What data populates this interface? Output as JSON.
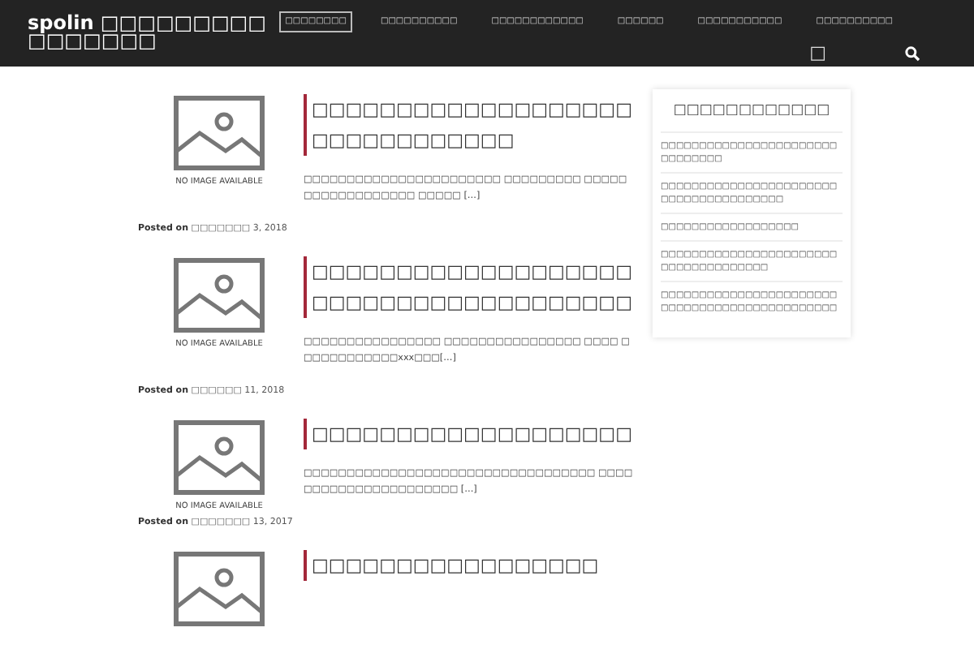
{
  "header": {
    "site_title": "spolin □□□□□□□□□ □□□□□□□",
    "nav": [
      {
        "label": "□□□□□□□□",
        "selected": true
      },
      {
        "label": "□□□□□□□□□□",
        "selected": false
      },
      {
        "label": "□□□□□□□□□□□□",
        "selected": false
      },
      {
        "label": "□□□□□□",
        "selected": false
      },
      {
        "label": "□□□□□□□□□□□",
        "selected": false
      },
      {
        "label": "□□□□□□□□□□",
        "selected": false
      },
      {
        "label": "□",
        "selected": false
      }
    ]
  },
  "posts": [
    {
      "image_text": "NO IMAGE AVAILABLE",
      "title": "□□□□□□□□□□□□□□□□□□□□□□□□□□□□□□□",
      "excerpt": "□□□□□□□□□□□□□□□□□□□□□□□ □□□□□□□□□ □□□□□□□□□□□□□□□□□□ □□□□□ […]",
      "posted_label": "Posted on",
      "date": "□□□□□□□ 3, 2018"
    },
    {
      "image_text": "NO IMAGE AVAILABLE",
      "title": "□□□□□□□□□□□□□□□□□□□□□□□□□□□□□□□□□□□□□□",
      "excerpt": "□□□□□□□□□□□□□□□□ □□□□□□□□□□□□□□□□ □□□□ □□□□□□□□□□□□xxx□□□[…]",
      "posted_label": "Posted on",
      "date": "□□□□□□ 11, 2018"
    },
    {
      "image_text": "NO IMAGE AVAILABLE",
      "title": "□□□□□□□□□□□□□□□□□□□",
      "excerpt": "□□□□□□□□□□□□□□□□□□□□□□□□□□□□□□□□□□ □□□□□□□□□□□□□□□□□□□□□□ […]",
      "posted_label": "Posted on",
      "date": "□□□□□□□ 13, 2017"
    },
    {
      "title": "□□□□□□□□□□□□□□□□□"
    }
  ],
  "sidebar": {
    "title": "□□□□□□□□□□□□",
    "items": [
      "□□□□□□□□□□□□□□□□□□□□□□□□□□□□□□□",
      "□□□□□□□□□□□□□□□□□□□□□□□□□□□□□□□□□□□□□□□",
      "□□□□□□□□□□□□□□□□□□",
      "□□□□□□□□□□□□□□□□□□□□□□□□□□□□□□□□□□□□□",
      "□□□□□□□□□□□□□□□□□□□□□□□□□□□□□□□□□□□□□□□□□□□□□□"
    ]
  }
}
